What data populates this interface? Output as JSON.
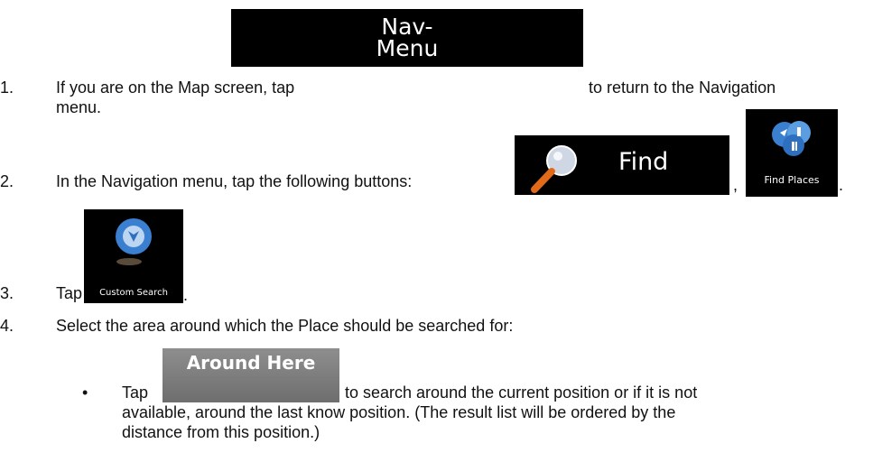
{
  "steps": [
    {
      "num": "1.",
      "text_before": "If you are on the Map screen, tap",
      "text_after": "to return to the Navigation",
      "text_line2": "menu."
    },
    {
      "num": "2.",
      "text_before": "In the Navigation menu, tap the following buttons:",
      "sep1": ",",
      "sep2": "."
    },
    {
      "num": "3.",
      "text_before": "Tap",
      "text_after": "."
    },
    {
      "num": "4.",
      "text": "Select the area around which the Place should be searched for:"
    }
  ],
  "bullet": {
    "symbol": "•",
    "text_before": "Tap",
    "text_after": "to search around the current position or if it is not",
    "line2": "available, around the last know position. (The result list will be ordered by the",
    "line3": "distance from this position.)"
  },
  "buttons": {
    "nav_menu": {
      "line1": "Nav-",
      "line2": "Menu"
    },
    "find": {
      "label": "Find",
      "icon": "magnifier-icon"
    },
    "find_places": {
      "label": "Find Places",
      "icon": "find-places-icon"
    },
    "custom_search": {
      "label": "Custom Search",
      "icon": "custom-search-icon"
    },
    "around_here": {
      "label": "Around Here"
    }
  },
  "colors": {
    "button_bg": "#000000",
    "around_here_bg": "#7c7c7c",
    "icon_blue": "#3a7fd0"
  }
}
